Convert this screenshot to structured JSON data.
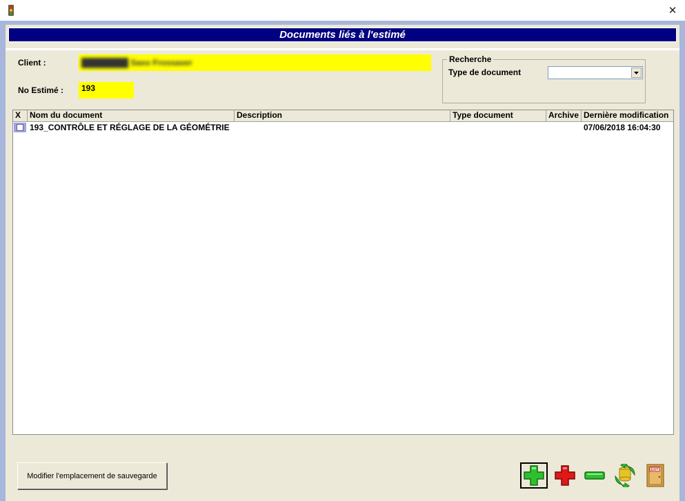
{
  "window": {
    "icon": "traffic-light-icon",
    "close_glyph": "✕"
  },
  "header": {
    "title": "Documents liés à l'estimé"
  },
  "form": {
    "client_label": "Client :",
    "client_value": "████████ Saxo Frossaser",
    "estimate_label": "No Estimé :",
    "estimate_value": "193"
  },
  "search": {
    "legend": "Recherche",
    "type_label": "Type de document",
    "type_value": ""
  },
  "table": {
    "columns": {
      "x": "X",
      "name": "Nom du document",
      "description": "Description",
      "type": "Type document",
      "archive": "Archive",
      "modified": "Dernière modification"
    },
    "rows": [
      {
        "name": "193_CONTRÔLE ET RÉGLAGE DE LA GÉOMÉTRIE",
        "description": "",
        "type": "",
        "archive": "",
        "modified": "07/06/2018 16:04:30"
      }
    ]
  },
  "footer": {
    "change_location_label": "Modifier l'emplacement de sauvegarde",
    "exit_text": "EXIT"
  },
  "colors": {
    "header_bg": "#000080",
    "field_highlight": "#ffff00",
    "frame": "#a8b6dc",
    "panel": "#ece9d8"
  }
}
